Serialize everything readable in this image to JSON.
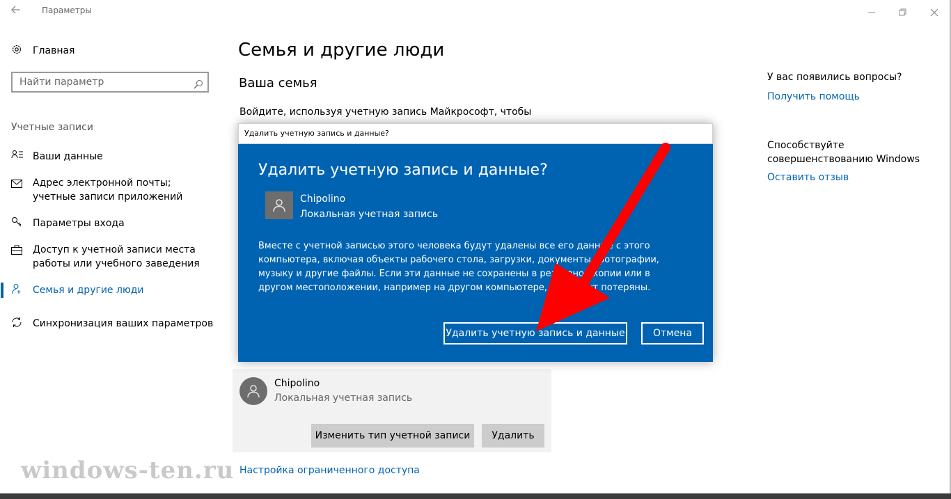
{
  "window": {
    "title": "Параметры",
    "back_icon": "back-arrow-icon",
    "controls": [
      "minimize-icon",
      "restore-icon",
      "close-icon"
    ]
  },
  "sidebar": {
    "home_label": "Главная",
    "search_placeholder": "Найти параметр",
    "section_title": "Учетные записи",
    "items": [
      {
        "icon": "person-list-icon",
        "label": "Ваши данные"
      },
      {
        "icon": "mail-icon",
        "label": "Адрес электронной почты; учетные записи приложений"
      },
      {
        "icon": "key-icon",
        "label": "Параметры входа"
      },
      {
        "icon": "briefcase-icon",
        "label": "Доступ к учетной записи места работы или учебного заведения"
      },
      {
        "icon": "people-icon",
        "label": "Семья и другие люди",
        "active": true
      },
      {
        "icon": "sync-icon",
        "label": "Синхронизация ваших параметров"
      }
    ]
  },
  "main": {
    "page_title": "Семья и другие люди",
    "family_heading": "Ваша семья",
    "family_text": "Войдите, используя учетную запись Майкрософт, чтобы",
    "user_card": {
      "name": "Chipolino",
      "type": "Локальная учетная запись",
      "change_type_button": "Изменить тип учетной записи",
      "delete_button": "Удалить"
    },
    "restricted_access_link": "Настройка ограниченного доступа"
  },
  "right_panel": {
    "question": "У вас появились вопросы?",
    "help_link": "Получить помощь",
    "improve_text": "Способствуйте совершенствованию Windows",
    "feedback_link": "Оставить отзыв"
  },
  "dialog": {
    "caption": "Удалить учетную запись и данные?",
    "title": "Удалить учетную запись и данные?",
    "user_name": "Chipolino",
    "user_type": "Локальная учетная запись",
    "message": "Вместе с учетной записью этого человека будут удалены все его данные с этого компьютера, включая объекты рабочего стола, загрузки, документы, фотографии, музыку и другие файлы. Если эти данные не сохранены в резервной копии или в другом местоположении, например на другом компьютере, они будут потеряны.",
    "confirm_button": "Удалить учетную запись и данные",
    "cancel_button": "Отмена",
    "background_color": "#0063b1"
  },
  "annotation": {
    "color": "#ff0000",
    "shape": "red-arrow"
  },
  "watermark": "windows-ten.ru"
}
